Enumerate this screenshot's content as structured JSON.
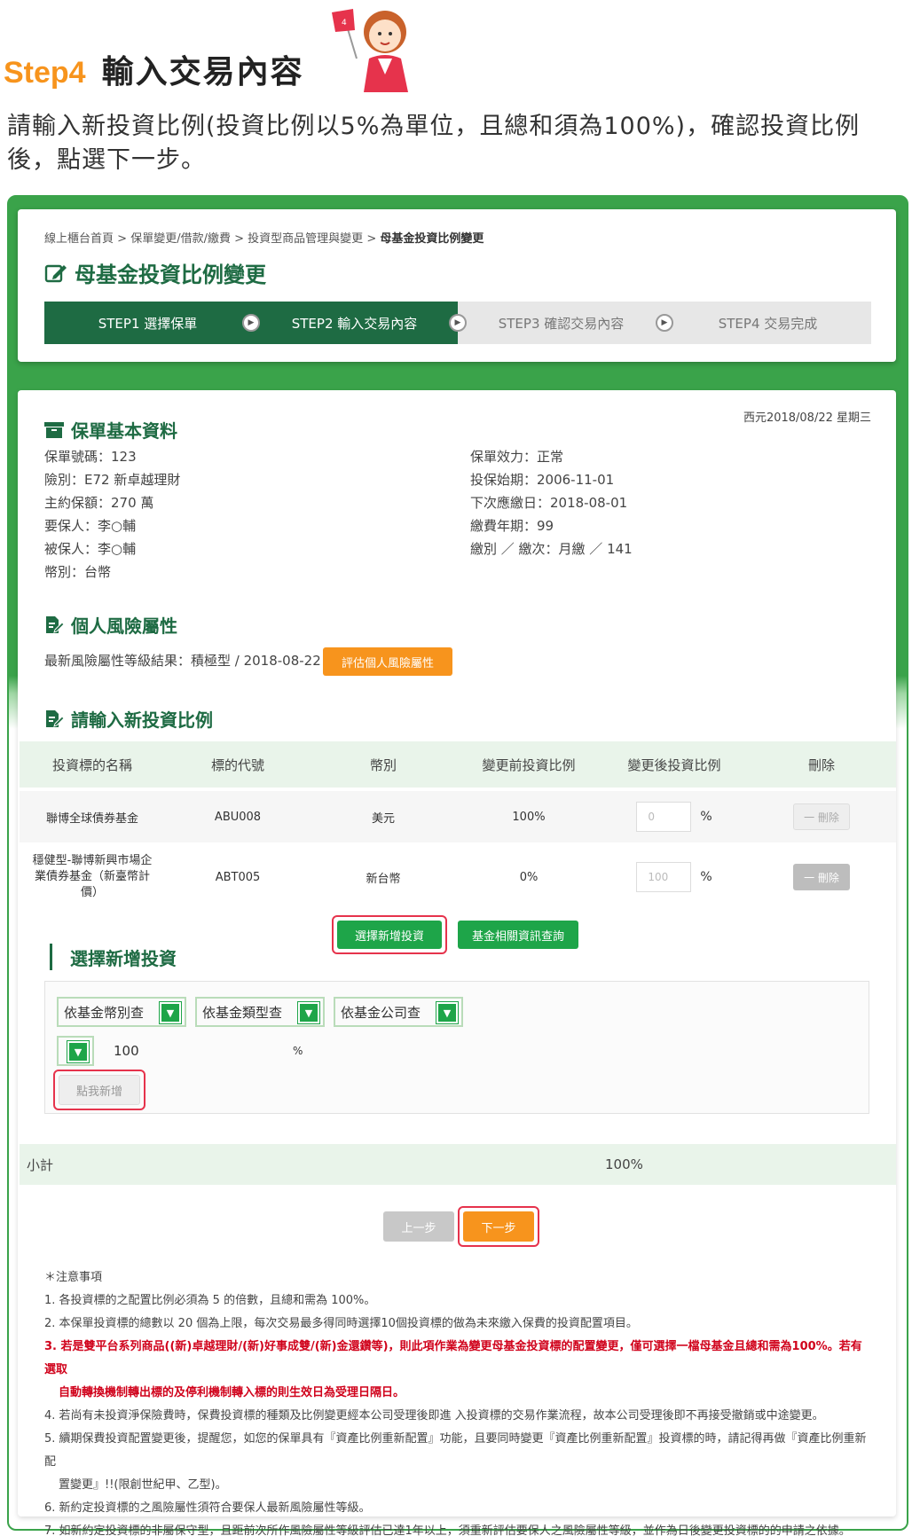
{
  "header": {
    "step_num": "Step4",
    "step_name": "輸入交易內容",
    "mascot_flag": "4",
    "intro": "請輸入新投資比例(投資比例以5%為單位，且總和須為100%)，確認投資比例後，點選下一步。"
  },
  "breadcrumb": {
    "items": [
      "線上櫃台首頁",
      "保單變更/借款/繳費",
      "投資型商品管理與變更"
    ],
    "current": "母基金投資比例變更",
    "separator": ">"
  },
  "page_title": "母基金投資比例變更",
  "steps": [
    {
      "label": "STEP1 選擇保單"
    },
    {
      "label": "STEP2 輸入交易內容"
    },
    {
      "label": "STEP3 確認交易內容"
    },
    {
      "label": "STEP4 交易完成"
    }
  ],
  "policy": {
    "heading": "保單基本資料",
    "date": "西元2018/08/22 星期三",
    "left": [
      "保單號碼：123",
      "險別：E72 新卓越理財",
      "主約保額：270 萬",
      "要保人：李○輔",
      "被保人：李○輔",
      "幣別：台幣"
    ],
    "right": [
      "保單效力：正常",
      "投保始期：2006-11-01",
      "下次應繳日：2018-08-01",
      "繳費年期：99",
      "繳別 ／ 繳次：月繳 ／ 141"
    ]
  },
  "risk": {
    "heading": "個人風險屬性",
    "result": "最新風險屬性等級結果：積極型 / 2018-08-22",
    "assess_button": "評估個人風險屬性"
  },
  "ratio": {
    "heading": "請輸入新投資比例",
    "columns": [
      "投資標的名稱",
      "標的代號",
      "幣別",
      "變更前投資比例",
      "變更後投資比例",
      "刪除"
    ],
    "rows": [
      {
        "name": "聯博全球債券基金",
        "code": "ABU008",
        "currency": "美元",
        "before": "100%",
        "after": "0",
        "pct": "%",
        "delete": "一 刪除"
      },
      {
        "name": "穩健型-聯博新興市場企業債券基金（新臺幣計價）",
        "code": "ABT005",
        "currency": "新台幣",
        "before": "0%",
        "after": "100",
        "pct": "%",
        "delete": "一 刪除"
      }
    ],
    "add_button": "選擇新增投資",
    "info_button": "基金相關資訊查詢"
  },
  "select_new": {
    "heading": "選擇新增投資",
    "dropdowns": [
      "依基金幣別查",
      "依基金類型查",
      "依基金公司查"
    ],
    "dropdown_arrow": "▼",
    "amount": "100",
    "pct": "%",
    "add_button": "點我新增"
  },
  "subtotal": {
    "label": "小計",
    "value": "100%"
  },
  "nav": {
    "prev": "上一步",
    "next": "下一步"
  },
  "notes": {
    "title": "＊注意事項",
    "items": [
      "1. 各投資標的之配置比例必須為 5 的倍數，且總和需為 100%。",
      "2. 本保單投資標的總數以 20 個為上限，每次交易最多得同時選擇10個投資標的做為未來繳入保費的投資配置項目。",
      "3. 若是雙平台系列商品((新)卓越理財/(新)好事成雙/(新)金還鑽等)，則此項作業為變更母基金投資標的配置變更，僅可選擇一檔母基金且總和需為100%。若有選取",
      "自動轉換機制轉出標的及停利機制轉入標的則生效日為受理日隔日。",
      "4. 若尚有未投資淨保險費時，保費投資標的種類及比例變更經本公司受理後即進 入投資標的交易作業流程，故本公司受理後即不再接受撤銷或中途變更。",
      "5. 續期保費投資配置變更後，提醒您，如您的保單具有『資產比例重新配置』功能，且要同時變更『資產比例重新配置』投資標的時，請記得再做『資產比例重新配",
      "置變更』!!(限創世紀甲、乙型)。",
      "6. 新約定投資標的之風險屬性須符合要保人最新風險屬性等級。",
      "7. 如新約定投資標的非屬保守型，且距前次所作風險屬性等級評估已達1年以上，須重新評估要保人之風險屬性等級，並作為日後變更投資標的的申請之依據。"
    ]
  },
  "colors": {
    "dark_green": "#1e6b43",
    "frame_green": "#3aa34a",
    "button_green": "#1ea549",
    "orange": "#f7941d",
    "highlight_red": "#e6334c",
    "note_red": "#d0021b"
  }
}
